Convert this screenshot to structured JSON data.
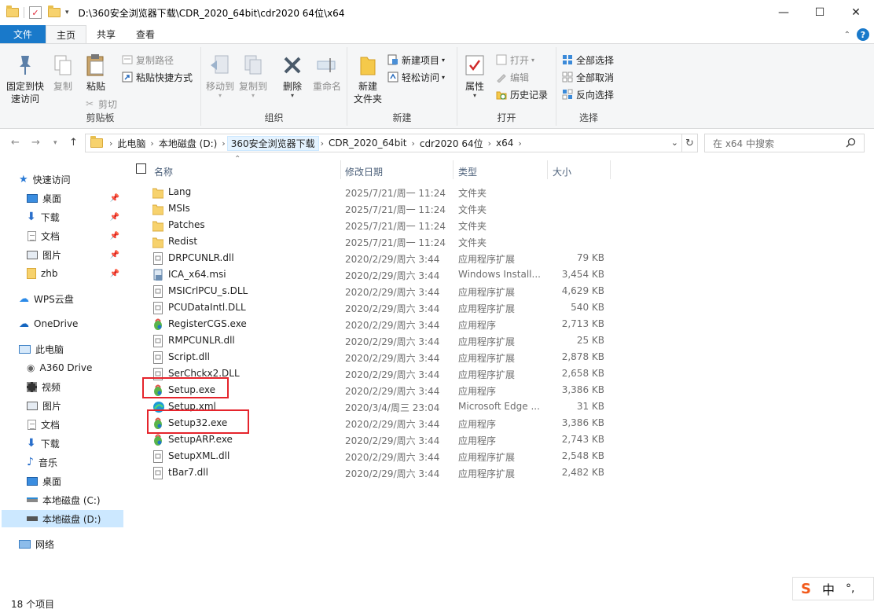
{
  "window": {
    "title": "D:\\360安全浏览器下载\\CDR_2020_64bit\\cdr2020 64位\\x64",
    "minimize": "—",
    "maximize": "☐",
    "close": "✕"
  },
  "ribbon": {
    "tabs": [
      "文件",
      "主页",
      "共享",
      "查看"
    ],
    "clipboard": {
      "pin": [
        "固定到快",
        "速访问"
      ],
      "copy": "复制",
      "paste": "粘贴",
      "copy_path": "复制路径",
      "paste_shortcut": "粘贴快捷方式",
      "cut": "剪切",
      "label": "剪贴板"
    },
    "organize": {
      "move_to": "移动到",
      "copy_to": "复制到",
      "delete": "删除",
      "rename": "重命名",
      "label": "组织"
    },
    "new": {
      "new_folder": [
        "新建",
        "文件夹"
      ],
      "new_item": "新建项目",
      "easy_access": "轻松访问",
      "label": "新建"
    },
    "open": {
      "properties": "属性",
      "open": "打开",
      "edit": "编辑",
      "history": "历史记录",
      "label": "打开"
    },
    "select": {
      "select_all": "全部选择",
      "select_none": "全部取消",
      "invert": "反向选择",
      "label": "选择"
    }
  },
  "address": {
    "crumbs": [
      "此电脑",
      "本地磁盘 (D:)",
      "360安全浏览器下载",
      "CDR_2020_64bit",
      "cdr2020 64位",
      "x64"
    ],
    "search_placeholder": "在 x64 中搜索"
  },
  "navpane": {
    "quick_access": "快速访问",
    "quick_items": [
      "桌面",
      "下载",
      "文档",
      "图片",
      "zhb"
    ],
    "wps": "WPS云盘",
    "onedrive": "OneDrive",
    "this_pc": "此电脑",
    "pc_items": [
      "A360 Drive",
      "视频",
      "图片",
      "文档",
      "下载",
      "音乐",
      "桌面",
      "本地磁盘 (C:)",
      "本地磁盘 (D:)"
    ],
    "network": "网络"
  },
  "columns": {
    "name": "名称",
    "date": "修改日期",
    "type": "类型",
    "size": "大小"
  },
  "files": [
    {
      "name": "Lang",
      "date": "2025/7/21/周一 11:24",
      "type": "文件夹",
      "size": "",
      "icon": "folder"
    },
    {
      "name": "MSIs",
      "date": "2025/7/21/周一 11:24",
      "type": "文件夹",
      "size": "",
      "icon": "folder"
    },
    {
      "name": "Patches",
      "date": "2025/7/21/周一 11:24",
      "type": "文件夹",
      "size": "",
      "icon": "folder"
    },
    {
      "name": "Redist",
      "date": "2025/7/21/周一 11:24",
      "type": "文件夹",
      "size": "",
      "icon": "folder"
    },
    {
      "name": "DRPCUNLR.dll",
      "date": "2020/2/29/周六 3:44",
      "type": "应用程序扩展",
      "size": "79 KB",
      "icon": "dll"
    },
    {
      "name": "ICA_x64.msi",
      "date": "2020/2/29/周六 3:44",
      "type": "Windows Install...",
      "size": "3,454 KB",
      "icon": "msi"
    },
    {
      "name": "MSICrlPCU_s.DLL",
      "date": "2020/2/29/周六 3:44",
      "type": "应用程序扩展",
      "size": "4,629 KB",
      "icon": "dll"
    },
    {
      "name": "PCUDataIntl.DLL",
      "date": "2020/2/29/周六 3:44",
      "type": "应用程序扩展",
      "size": "540 KB",
      "icon": "dll"
    },
    {
      "name": "RegisterCGS.exe",
      "date": "2020/2/29/周六 3:44",
      "type": "应用程序",
      "size": "2,713 KB",
      "icon": "corel"
    },
    {
      "name": "RMPCUNLR.dll",
      "date": "2020/2/29/周六 3:44",
      "type": "应用程序扩展",
      "size": "25 KB",
      "icon": "dll"
    },
    {
      "name": "Script.dll",
      "date": "2020/2/29/周六 3:44",
      "type": "应用程序扩展",
      "size": "2,878 KB",
      "icon": "dll"
    },
    {
      "name": "SerChckx2.DLL",
      "date": "2020/2/29/周六 3:44",
      "type": "应用程序扩展",
      "size": "2,658 KB",
      "icon": "dll"
    },
    {
      "name": "Setup.exe",
      "date": "2020/2/29/周六 3:44",
      "type": "应用程序",
      "size": "3,386 KB",
      "icon": "corel"
    },
    {
      "name": "Setup.xml",
      "date": "2020/3/4/周三 23:04",
      "type": "Microsoft Edge ...",
      "size": "31 KB",
      "icon": "edge"
    },
    {
      "name": "Setup32.exe",
      "date": "2020/2/29/周六 3:44",
      "type": "应用程序",
      "size": "3,386 KB",
      "icon": "corel"
    },
    {
      "name": "SetupARP.exe",
      "date": "2020/2/29/周六 3:44",
      "type": "应用程序",
      "size": "2,743 KB",
      "icon": "corel"
    },
    {
      "name": "SetupXML.dll",
      "date": "2020/2/29/周六 3:44",
      "type": "应用程序扩展",
      "size": "2,548 KB",
      "icon": "dll"
    },
    {
      "name": "tBar7.dll",
      "date": "2020/2/29/周六 3:44",
      "type": "应用程序扩展",
      "size": "2,482 KB",
      "icon": "dll"
    }
  ],
  "status": {
    "count": "18 个项目"
  },
  "ime": {
    "logo": "S",
    "mode": "中",
    "punct": "°,"
  }
}
